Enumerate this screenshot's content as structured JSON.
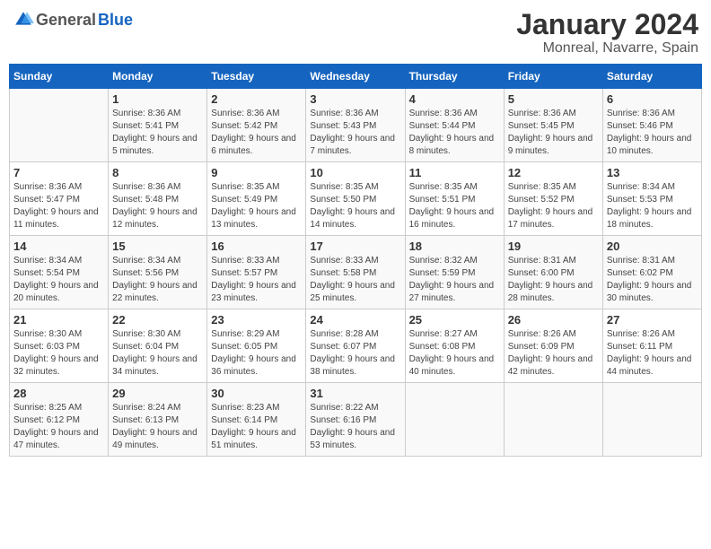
{
  "header": {
    "logo_general": "General",
    "logo_blue": "Blue",
    "month": "January 2024",
    "location": "Monreal, Navarre, Spain"
  },
  "weekdays": [
    "Sunday",
    "Monday",
    "Tuesday",
    "Wednesday",
    "Thursday",
    "Friday",
    "Saturday"
  ],
  "weeks": [
    [
      {
        "day": "",
        "sunrise": "",
        "sunset": "",
        "daylight": ""
      },
      {
        "day": "1",
        "sunrise": "Sunrise: 8:36 AM",
        "sunset": "Sunset: 5:41 PM",
        "daylight": "Daylight: 9 hours and 5 minutes."
      },
      {
        "day": "2",
        "sunrise": "Sunrise: 8:36 AM",
        "sunset": "Sunset: 5:42 PM",
        "daylight": "Daylight: 9 hours and 6 minutes."
      },
      {
        "day": "3",
        "sunrise": "Sunrise: 8:36 AM",
        "sunset": "Sunset: 5:43 PM",
        "daylight": "Daylight: 9 hours and 7 minutes."
      },
      {
        "day": "4",
        "sunrise": "Sunrise: 8:36 AM",
        "sunset": "Sunset: 5:44 PM",
        "daylight": "Daylight: 9 hours and 8 minutes."
      },
      {
        "day": "5",
        "sunrise": "Sunrise: 8:36 AM",
        "sunset": "Sunset: 5:45 PM",
        "daylight": "Daylight: 9 hours and 9 minutes."
      },
      {
        "day": "6",
        "sunrise": "Sunrise: 8:36 AM",
        "sunset": "Sunset: 5:46 PM",
        "daylight": "Daylight: 9 hours and 10 minutes."
      }
    ],
    [
      {
        "day": "7",
        "sunrise": "Sunrise: 8:36 AM",
        "sunset": "Sunset: 5:47 PM",
        "daylight": "Daylight: 9 hours and 11 minutes."
      },
      {
        "day": "8",
        "sunrise": "Sunrise: 8:36 AM",
        "sunset": "Sunset: 5:48 PM",
        "daylight": "Daylight: 9 hours and 12 minutes."
      },
      {
        "day": "9",
        "sunrise": "Sunrise: 8:35 AM",
        "sunset": "Sunset: 5:49 PM",
        "daylight": "Daylight: 9 hours and 13 minutes."
      },
      {
        "day": "10",
        "sunrise": "Sunrise: 8:35 AM",
        "sunset": "Sunset: 5:50 PM",
        "daylight": "Daylight: 9 hours and 14 minutes."
      },
      {
        "day": "11",
        "sunrise": "Sunrise: 8:35 AM",
        "sunset": "Sunset: 5:51 PM",
        "daylight": "Daylight: 9 hours and 16 minutes."
      },
      {
        "day": "12",
        "sunrise": "Sunrise: 8:35 AM",
        "sunset": "Sunset: 5:52 PM",
        "daylight": "Daylight: 9 hours and 17 minutes."
      },
      {
        "day": "13",
        "sunrise": "Sunrise: 8:34 AM",
        "sunset": "Sunset: 5:53 PM",
        "daylight": "Daylight: 9 hours and 18 minutes."
      }
    ],
    [
      {
        "day": "14",
        "sunrise": "Sunrise: 8:34 AM",
        "sunset": "Sunset: 5:54 PM",
        "daylight": "Daylight: 9 hours and 20 minutes."
      },
      {
        "day": "15",
        "sunrise": "Sunrise: 8:34 AM",
        "sunset": "Sunset: 5:56 PM",
        "daylight": "Daylight: 9 hours and 22 minutes."
      },
      {
        "day": "16",
        "sunrise": "Sunrise: 8:33 AM",
        "sunset": "Sunset: 5:57 PM",
        "daylight": "Daylight: 9 hours and 23 minutes."
      },
      {
        "day": "17",
        "sunrise": "Sunrise: 8:33 AM",
        "sunset": "Sunset: 5:58 PM",
        "daylight": "Daylight: 9 hours and 25 minutes."
      },
      {
        "day": "18",
        "sunrise": "Sunrise: 8:32 AM",
        "sunset": "Sunset: 5:59 PM",
        "daylight": "Daylight: 9 hours and 27 minutes."
      },
      {
        "day": "19",
        "sunrise": "Sunrise: 8:31 AM",
        "sunset": "Sunset: 6:00 PM",
        "daylight": "Daylight: 9 hours and 28 minutes."
      },
      {
        "day": "20",
        "sunrise": "Sunrise: 8:31 AM",
        "sunset": "Sunset: 6:02 PM",
        "daylight": "Daylight: 9 hours and 30 minutes."
      }
    ],
    [
      {
        "day": "21",
        "sunrise": "Sunrise: 8:30 AM",
        "sunset": "Sunset: 6:03 PM",
        "daylight": "Daylight: 9 hours and 32 minutes."
      },
      {
        "day": "22",
        "sunrise": "Sunrise: 8:30 AM",
        "sunset": "Sunset: 6:04 PM",
        "daylight": "Daylight: 9 hours and 34 minutes."
      },
      {
        "day": "23",
        "sunrise": "Sunrise: 8:29 AM",
        "sunset": "Sunset: 6:05 PM",
        "daylight": "Daylight: 9 hours and 36 minutes."
      },
      {
        "day": "24",
        "sunrise": "Sunrise: 8:28 AM",
        "sunset": "Sunset: 6:07 PM",
        "daylight": "Daylight: 9 hours and 38 minutes."
      },
      {
        "day": "25",
        "sunrise": "Sunrise: 8:27 AM",
        "sunset": "Sunset: 6:08 PM",
        "daylight": "Daylight: 9 hours and 40 minutes."
      },
      {
        "day": "26",
        "sunrise": "Sunrise: 8:26 AM",
        "sunset": "Sunset: 6:09 PM",
        "daylight": "Daylight: 9 hours and 42 minutes."
      },
      {
        "day": "27",
        "sunrise": "Sunrise: 8:26 AM",
        "sunset": "Sunset: 6:11 PM",
        "daylight": "Daylight: 9 hours and 44 minutes."
      }
    ],
    [
      {
        "day": "28",
        "sunrise": "Sunrise: 8:25 AM",
        "sunset": "Sunset: 6:12 PM",
        "daylight": "Daylight: 9 hours and 47 minutes."
      },
      {
        "day": "29",
        "sunrise": "Sunrise: 8:24 AM",
        "sunset": "Sunset: 6:13 PM",
        "daylight": "Daylight: 9 hours and 49 minutes."
      },
      {
        "day": "30",
        "sunrise": "Sunrise: 8:23 AM",
        "sunset": "Sunset: 6:14 PM",
        "daylight": "Daylight: 9 hours and 51 minutes."
      },
      {
        "day": "31",
        "sunrise": "Sunrise: 8:22 AM",
        "sunset": "Sunset: 6:16 PM",
        "daylight": "Daylight: 9 hours and 53 minutes."
      },
      {
        "day": "",
        "sunrise": "",
        "sunset": "",
        "daylight": ""
      },
      {
        "day": "",
        "sunrise": "",
        "sunset": "",
        "daylight": ""
      },
      {
        "day": "",
        "sunrise": "",
        "sunset": "",
        "daylight": ""
      }
    ]
  ]
}
